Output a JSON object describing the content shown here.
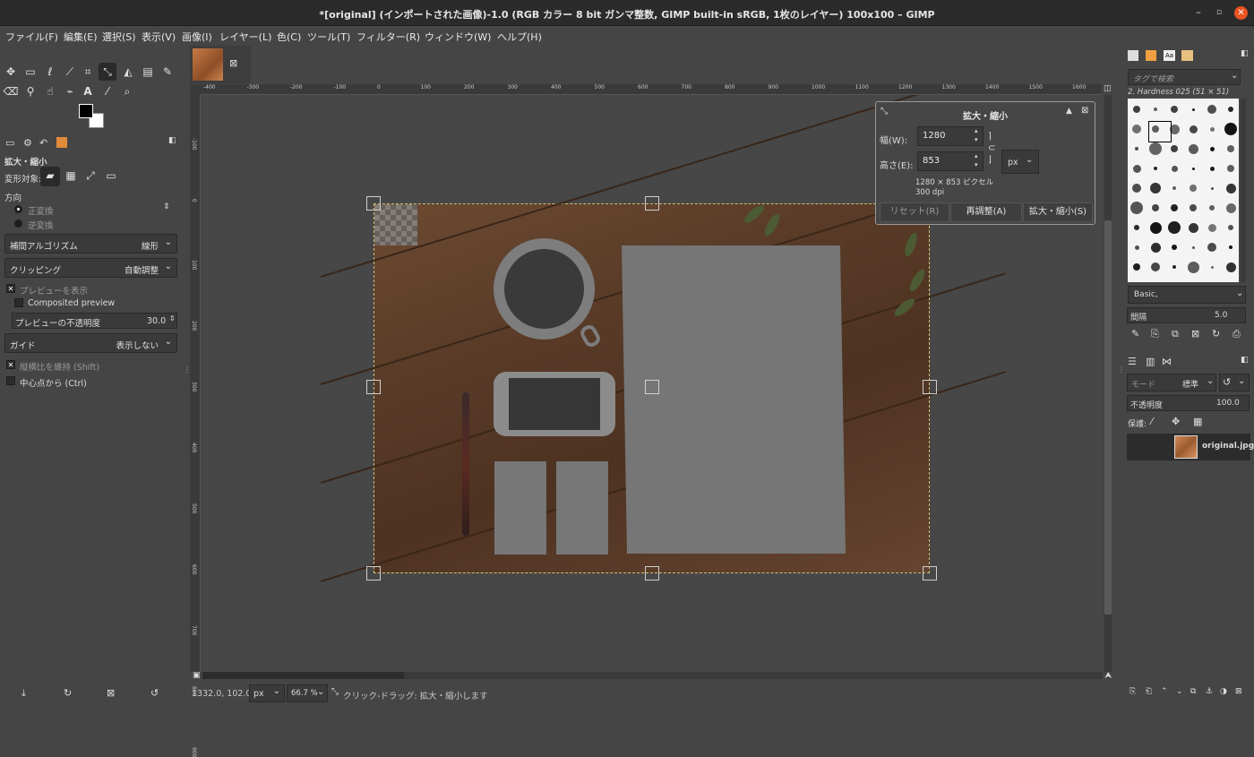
{
  "window": {
    "title": "*[original] (インポートされた画像)-1.0 (RGB カラー 8 bit ガンマ整数, GIMP built-in sRGB, 1枚のレイヤー) 100x100 – GIMP",
    "minimize": "–",
    "maximize": "▫",
    "close": "✕"
  },
  "menu": [
    "ファイル(F)",
    "編集(E)",
    "選択(S)",
    "表示(V)",
    "画像(I)",
    "レイヤー(L)",
    "色(C)",
    "ツール(T)",
    "フィルター(R)",
    "ウィンドウ(W)",
    "ヘルプ(H)"
  ],
  "toolbox": {
    "row1": [
      "move-icon",
      "rect-select-icon",
      "lasso-icon",
      "fuzzy-select-icon",
      "crop-icon",
      "scale-icon",
      "bucket-icon",
      "gradient-icon",
      "paintbrush-icon"
    ],
    "row2": [
      "eraser-icon",
      "clone-icon",
      "smudge-icon",
      "paths-icon",
      "text-icon",
      "color-picker-icon",
      "zoom-icon"
    ]
  },
  "tool_options": {
    "title": "拡大・縮小",
    "transform_label": "変形対象:",
    "direction_label": "方向",
    "direction_normal": "正変換",
    "direction_reverse": "逆変換",
    "interpolation_label": "補間アルゴリズム",
    "interpolation_value": "線形",
    "clipping_label": "クリッピング",
    "clipping_value": "自動調整",
    "show_preview": "プレビューを表示",
    "composited_preview": "Composited preview",
    "preview_opacity_label": "プレビューの不透明度",
    "preview_opacity_value": "30.0",
    "guides_label": "ガイド",
    "guides_value": "表示しない",
    "keep_aspect": "縦横比を維持 (Shift)",
    "from_center": "中心点から (Ctrl)"
  },
  "ruler": {
    "h_ticks": [
      "-400",
      "-300",
      "-200",
      "-100",
      "0",
      "100",
      "200",
      "300",
      "400",
      "500",
      "600",
      "700",
      "800",
      "900",
      "1000",
      "1100",
      "1200",
      "1300",
      "1400",
      "1500",
      "1600"
    ],
    "v_ticks": [
      "-100",
      "0",
      "100",
      "200",
      "300",
      "400",
      "500",
      "600",
      "700",
      "800",
      "900"
    ]
  },
  "scale_dialog": {
    "title": "拡大・縮小",
    "width_label": "幅(W):",
    "width_value": "1280",
    "height_label": "高さ(E):",
    "height_value": "853",
    "unit": "px",
    "size_info": "1280 × 853 ピクセル",
    "dpi_info": "300 dpi",
    "reset_button": "リセット(R)",
    "readjust_button": "再調整(A)",
    "scale_button": "拡大・縮小(S)"
  },
  "statusbar": {
    "coords": "1332.0, 102.0",
    "unit": "px",
    "zoom": "66.7 %",
    "message": "クリック-ドラッグ: 拡大・縮小します"
  },
  "brushes": {
    "filter_placeholder": "タグで検索",
    "current_brush": "2. Hardness 025 (51 × 51)",
    "preset": "Basic,",
    "spacing_label": "間隔",
    "spacing_value": "5.0"
  },
  "layers": {
    "mode_label": "モード",
    "mode_value": "標準",
    "opacity_label": "不透明度",
    "opacity_value": "100.0",
    "lock_label": "保護:",
    "layer_name": "original.jpg"
  }
}
